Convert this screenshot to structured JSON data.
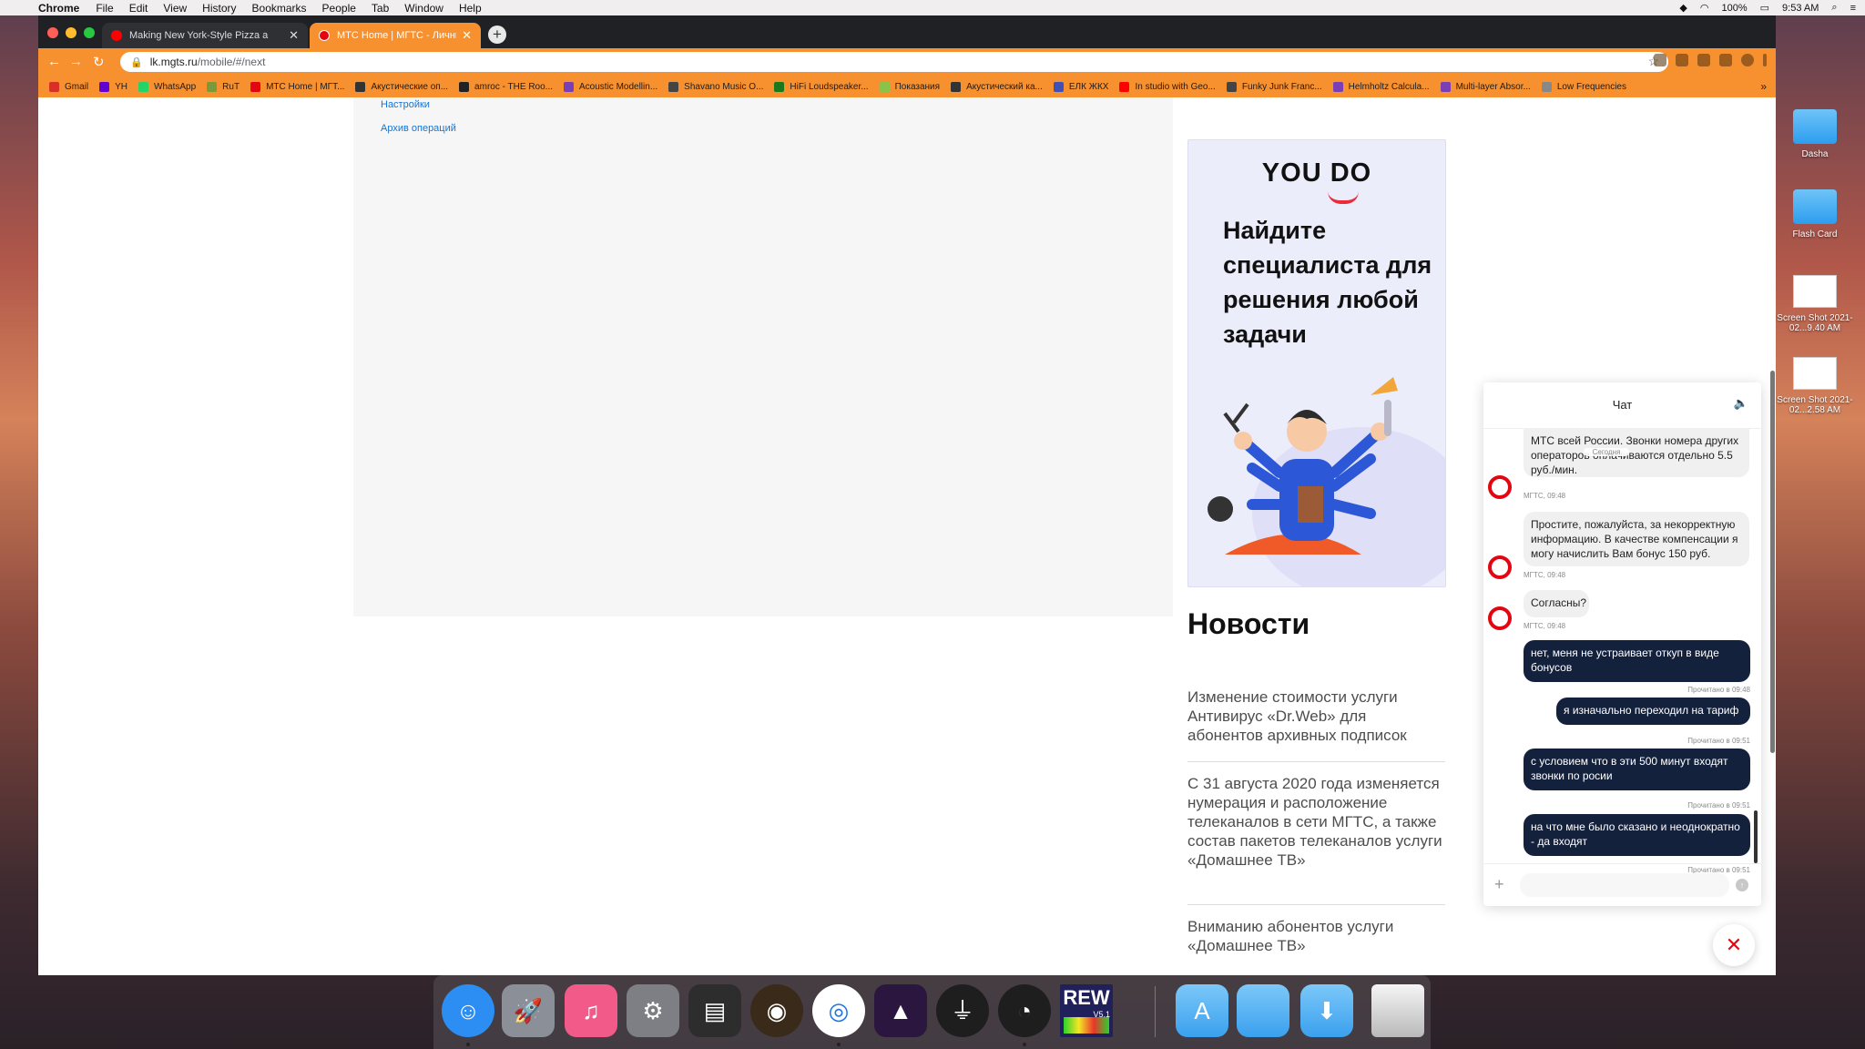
{
  "menubar": {
    "items": [
      "Chrome",
      "File",
      "Edit",
      "View",
      "History",
      "Bookmarks",
      "People",
      "Tab",
      "Window",
      "Help"
    ],
    "battery": "100%",
    "time": "9:53 AM"
  },
  "tabs": [
    {
      "title": "Making New York-Style Pizza a"
    },
    {
      "title": "МТС Home | МГТС - Личный к"
    }
  ],
  "address": {
    "host": "lk.mgts.ru",
    "path": "/mobile/#/next"
  },
  "bookmarks": [
    {
      "label": "Gmail",
      "color": "#d93025"
    },
    {
      "label": "YH",
      "color": "#6001d2"
    },
    {
      "label": "WhatsApp",
      "color": "#25d366"
    },
    {
      "label": "RuT",
      "color": "#7a9a3a"
    },
    {
      "label": "МТС Home | МГТ...",
      "color": "#e30611"
    },
    {
      "label": "Акустические оп...",
      "color": "#333333"
    },
    {
      "label": "amroc - THE Roo...",
      "color": "#222222"
    },
    {
      "label": "Acoustic Modellin...",
      "color": "#7b3fb5"
    },
    {
      "label": "Shavano Music O...",
      "color": "#444444"
    },
    {
      "label": "HiFi Loudspeaker...",
      "color": "#1a7a1a"
    },
    {
      "label": "Показания",
      "color": "#8bc34a"
    },
    {
      "label": "Акустический ка...",
      "color": "#333333"
    },
    {
      "label": "ЕЛК ЖКХ",
      "color": "#3f51b5"
    },
    {
      "label": "In studio with Geo...",
      "color": "#ff0000"
    },
    {
      "label": "Funky Junk Franc...",
      "color": "#444444"
    },
    {
      "label": "Helmholtz Calcula...",
      "color": "#7b3fb5"
    },
    {
      "label": "Multi-layer Absor...",
      "color": "#7b3fb5"
    },
    {
      "label": "Low Frequencies",
      "color": "#888888"
    }
  ],
  "sidebar_links": {
    "settings": "Настройки",
    "archive": "Архив операций"
  },
  "ad": {
    "logo_you": "YOU",
    "logo_do": "DO",
    "text": "Найдите специалиста для решения любой задачи"
  },
  "news": {
    "title": "Новости",
    "items": [
      "Изменение стоимости услуги Антивирус «Dr.Web» для абонентов архивных подписок",
      "С 31 августа 2020 года изменяется нумерация и расположение телеканалов в сети МГТС, а также состав пакетов телеканалов услуги «Домашнее ТВ»",
      "Вниманию абонентов услуги «Домашнее ТВ»"
    ]
  },
  "chat": {
    "title": "Чат",
    "today": "Сегодня",
    "messages": [
      {
        "dir": "in",
        "text": "МТС всей России. Звонки номера других операторов оплачиваются отдельно 5.5 руб./мин.",
        "meta": "МГТС, 09:48"
      },
      {
        "dir": "in",
        "text": "Простите, пожалуйста, за некорректную информацию. В качестве компенсации я могу начислить Вам бонус 150 руб.",
        "meta": "МГТС, 09:48"
      },
      {
        "dir": "in",
        "text": "Согласны?",
        "meta": "МГТС, 09:48"
      },
      {
        "dir": "out",
        "text": "нет, меня не устраивает откуп в виде бонусов",
        "meta": "Прочитано в 09:48"
      },
      {
        "dir": "out",
        "text": "я изначально переходил на тариф",
        "meta": "Прочитано в 09:51"
      },
      {
        "dir": "out",
        "text": "с условием что в эти 500 минут входят звонки по росии",
        "meta": "Прочитано в 09:51"
      },
      {
        "dir": "out",
        "text": "на что мне было сказано и неоднократно - да входят",
        "meta": "Прочитано в 09:51"
      }
    ],
    "input_value": ""
  },
  "desktop": [
    {
      "label": "Dasha",
      "kind": "folder"
    },
    {
      "label": "Flash Card",
      "kind": "folder"
    },
    {
      "label": "Screen Shot 2021-02...9.40 AM",
      "kind": "screenshot"
    },
    {
      "label": "Screen Shot 2021-02...2.58 AM",
      "kind": "screenshot"
    }
  ],
  "dock": {
    "rew_label": "REW",
    "rew_version": "V5.1",
    "apps": [
      {
        "name": "finder",
        "color": "#2c8ef2",
        "glyph": "☺"
      },
      {
        "name": "launchpad",
        "color": "#8a8f98",
        "glyph": "🚀"
      },
      {
        "name": "itunes",
        "color": "#f25a8a",
        "glyph": "♫"
      },
      {
        "name": "system-preferences",
        "color": "#7d7f85",
        "glyph": "⚙"
      },
      {
        "name": "image-capture",
        "color": "#2d2d2d",
        "glyph": "▤"
      },
      {
        "name": "speaker-app",
        "color": "#3a2a1a",
        "glyph": "◉"
      },
      {
        "name": "chrome",
        "color": "#ffffff",
        "glyph": "◎"
      },
      {
        "name": "pro-tools",
        "color": "#2b1640",
        "glyph": "▲"
      },
      {
        "name": "ua-console",
        "color": "#1e1e1e",
        "glyph": "⏚"
      },
      {
        "name": "ua-meter",
        "color": "#1e1e1e",
        "glyph": "◔"
      },
      {
        "name": "rew",
        "color": "#20205a",
        "glyph": ""
      }
    ]
  }
}
